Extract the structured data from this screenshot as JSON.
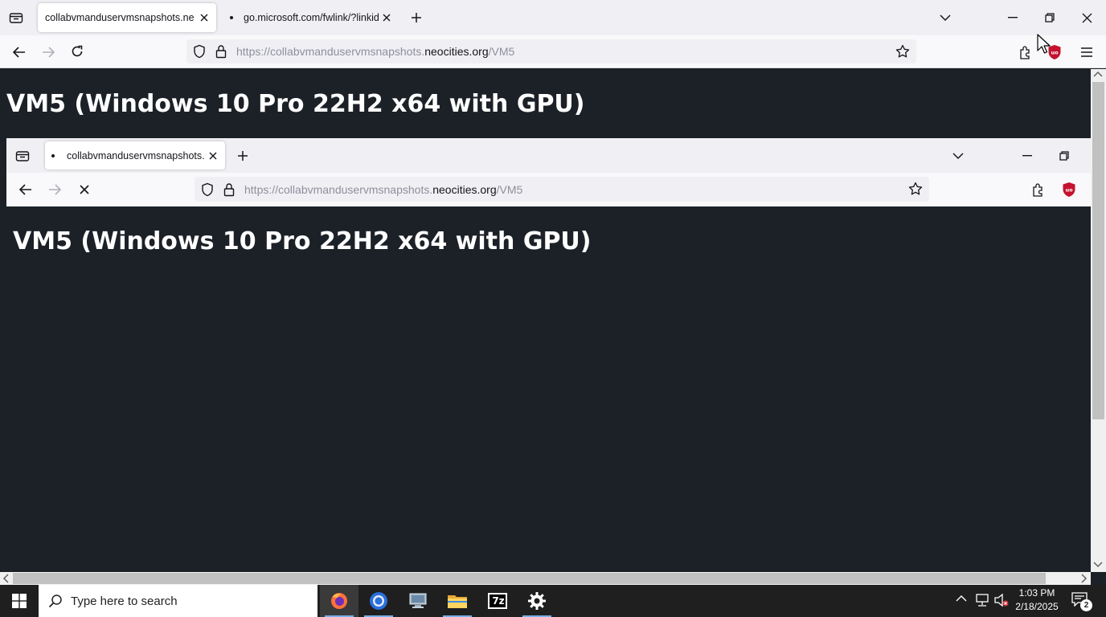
{
  "outer_browser": {
    "tabs": [
      {
        "title": "collabvmanduservmsnapshots.neocities.org",
        "active": true
      },
      {
        "title": "go.microsoft.com/fwlink/?linkid=",
        "active": false
      }
    ],
    "url": {
      "prefix": "https://collabvmanduservmsnapshots.",
      "domain": "neocities.org",
      "path": "/VM5"
    }
  },
  "page": {
    "heading": "VM5 (Windows 10 Pro 22H2 x64 with GPU)"
  },
  "inner_browser": {
    "tabs": [
      {
        "title": "collabvmanduservmsnapshots.neocities.org",
        "active": true
      }
    ],
    "url": {
      "prefix": "https://collabvmanduservmsnapshots.",
      "domain": "neocities.org",
      "path": "/VM5"
    },
    "heading": "VM5 (Windows 10 Pro 22H2 x64 with GPU)"
  },
  "taskbar": {
    "search_placeholder": "Type here to search",
    "apps": [
      "firefox-icon",
      "chrome-icon",
      "network-computer-icon",
      "file-explorer-icon",
      "7zip-icon",
      "settings-icon"
    ],
    "time": "1:03 PM",
    "date": "2/18/2025",
    "notification_count": "2",
    "seven_zip_label": "7z"
  },
  "colors": {
    "page_bg": "#1c2128",
    "taskbar_bg": "#1f1f1f",
    "ublock_red": "#c4122f"
  }
}
